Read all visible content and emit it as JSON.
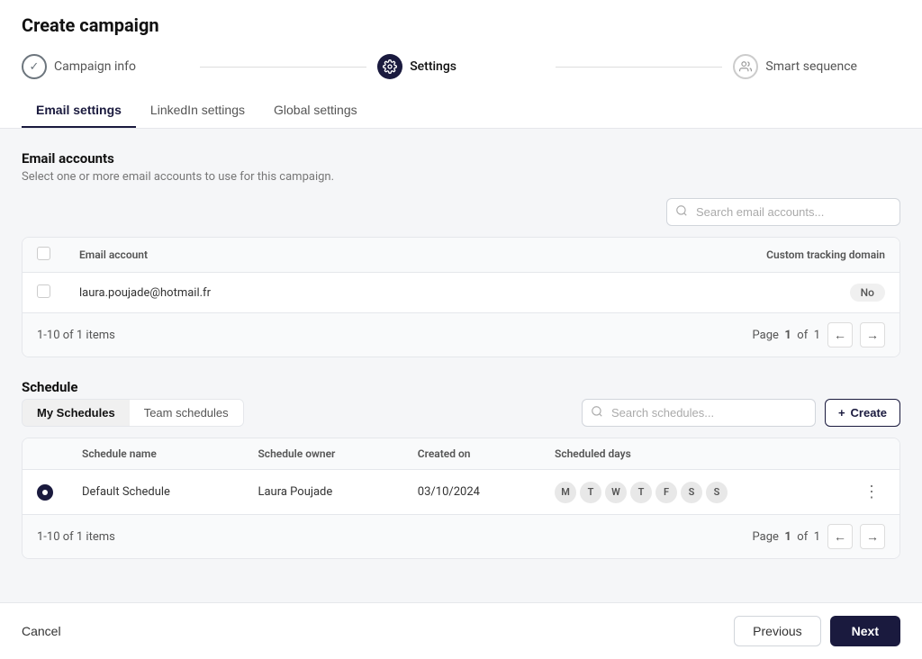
{
  "page": {
    "title": "Create campaign"
  },
  "steps": [
    {
      "id": "campaign-info",
      "label": "Campaign info",
      "state": "done"
    },
    {
      "id": "settings",
      "label": "Settings",
      "state": "active"
    },
    {
      "id": "smart-sequence",
      "label": "Smart sequence",
      "state": "inactive"
    }
  ],
  "tabs": [
    {
      "id": "email-settings",
      "label": "Email settings",
      "active": true
    },
    {
      "id": "linkedin-settings",
      "label": "LinkedIn settings",
      "active": false
    },
    {
      "id": "global-settings",
      "label": "Global settings",
      "active": false
    }
  ],
  "email_accounts": {
    "section_title": "Email accounts",
    "section_desc": "Select one or more email accounts to use for this campaign.",
    "search_placeholder": "Search email accounts...",
    "table": {
      "headers": [
        "Email account",
        "Custom tracking domain"
      ],
      "rows": [
        {
          "email": "laura.poujade@hotmail.fr",
          "tracking": "No"
        }
      ]
    },
    "pagination": {
      "info": "1-10 of 1 items",
      "page_label": "Page",
      "page_current": "1",
      "page_of": "of",
      "page_total": "1"
    }
  },
  "schedule": {
    "section_title": "Schedule",
    "tabs": [
      {
        "id": "my-schedules",
        "label": "My Schedules",
        "active": true
      },
      {
        "id": "team-schedules",
        "label": "Team schedules",
        "active": false
      }
    ],
    "search_placeholder": "Search schedules...",
    "create_label": "Create",
    "table": {
      "headers": [
        "Schedule name",
        "Schedule owner",
        "Created on",
        "Scheduled days"
      ],
      "rows": [
        {
          "name": "Default Schedule",
          "owner": "Laura Poujade",
          "created_on": "03/10/2024",
          "days": [
            "M",
            "T",
            "W",
            "T",
            "F",
            "S",
            "S"
          ],
          "selected": true
        }
      ]
    },
    "pagination": {
      "info": "1-10 of 1 items",
      "page_label": "Page",
      "page_current": "1",
      "page_of": "of",
      "page_total": "1"
    }
  },
  "footer": {
    "cancel_label": "Cancel",
    "previous_label": "Previous",
    "next_label": "Next"
  }
}
